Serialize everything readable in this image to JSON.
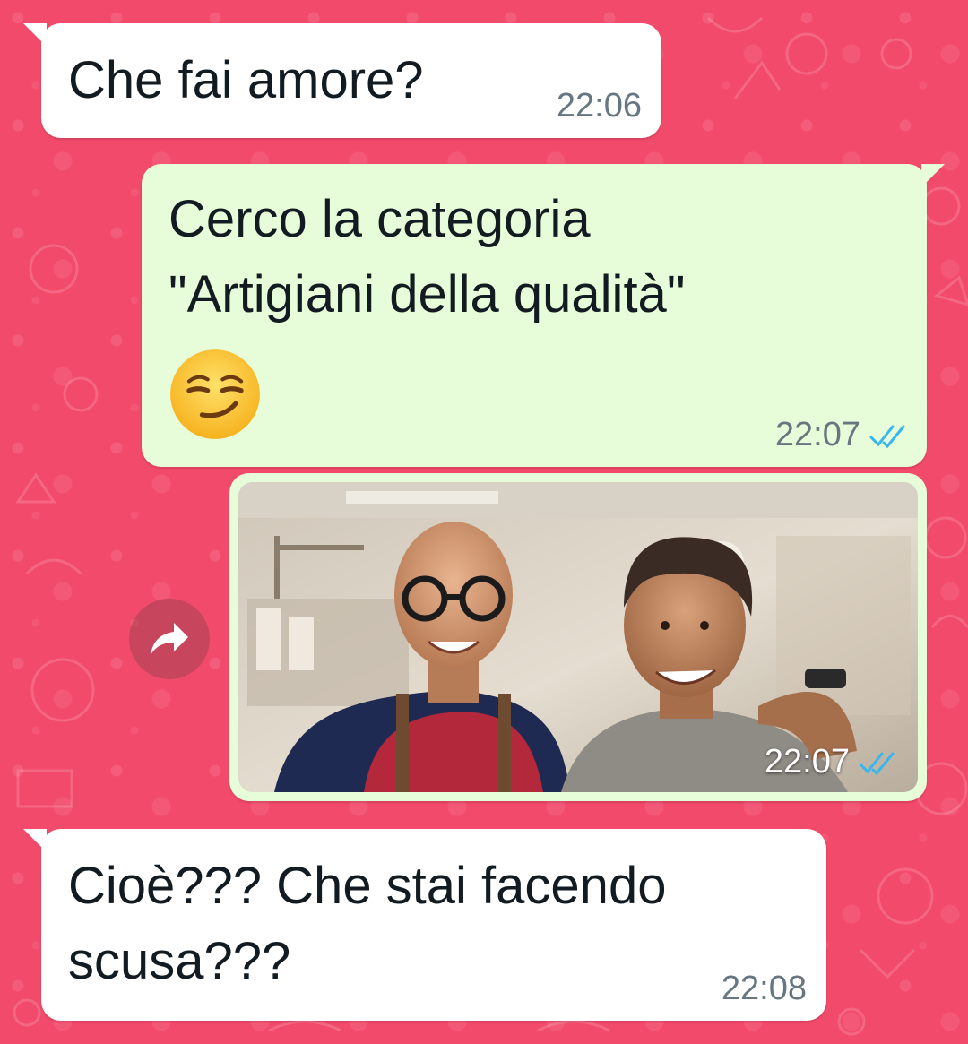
{
  "colors": {
    "wallpaper": "#f24a6b",
    "incoming_bubble": "#ffffff",
    "outgoing_bubble": "#e7fcd8",
    "timestamp": "#667781",
    "read_ticks": "#34b7f1"
  },
  "messages": [
    {
      "direction": "incoming",
      "text": "Che fai amore?",
      "time": "22:06"
    },
    {
      "direction": "outgoing",
      "lines": [
        "Cerco la categoria",
        "\"Artigiani della qualità\""
      ],
      "emoji": "smirking-face",
      "time": "22:07",
      "status": "read"
    },
    {
      "direction": "outgoing",
      "type": "image",
      "image_description": "two-smiling-men-in-workshop",
      "time": "22:07",
      "status": "read"
    },
    {
      "direction": "incoming",
      "lines": [
        "Cioè??? Che stai facendo",
        "scusa???"
      ],
      "time": "22:08"
    }
  ],
  "forward_icon": "forward-arrow-icon"
}
